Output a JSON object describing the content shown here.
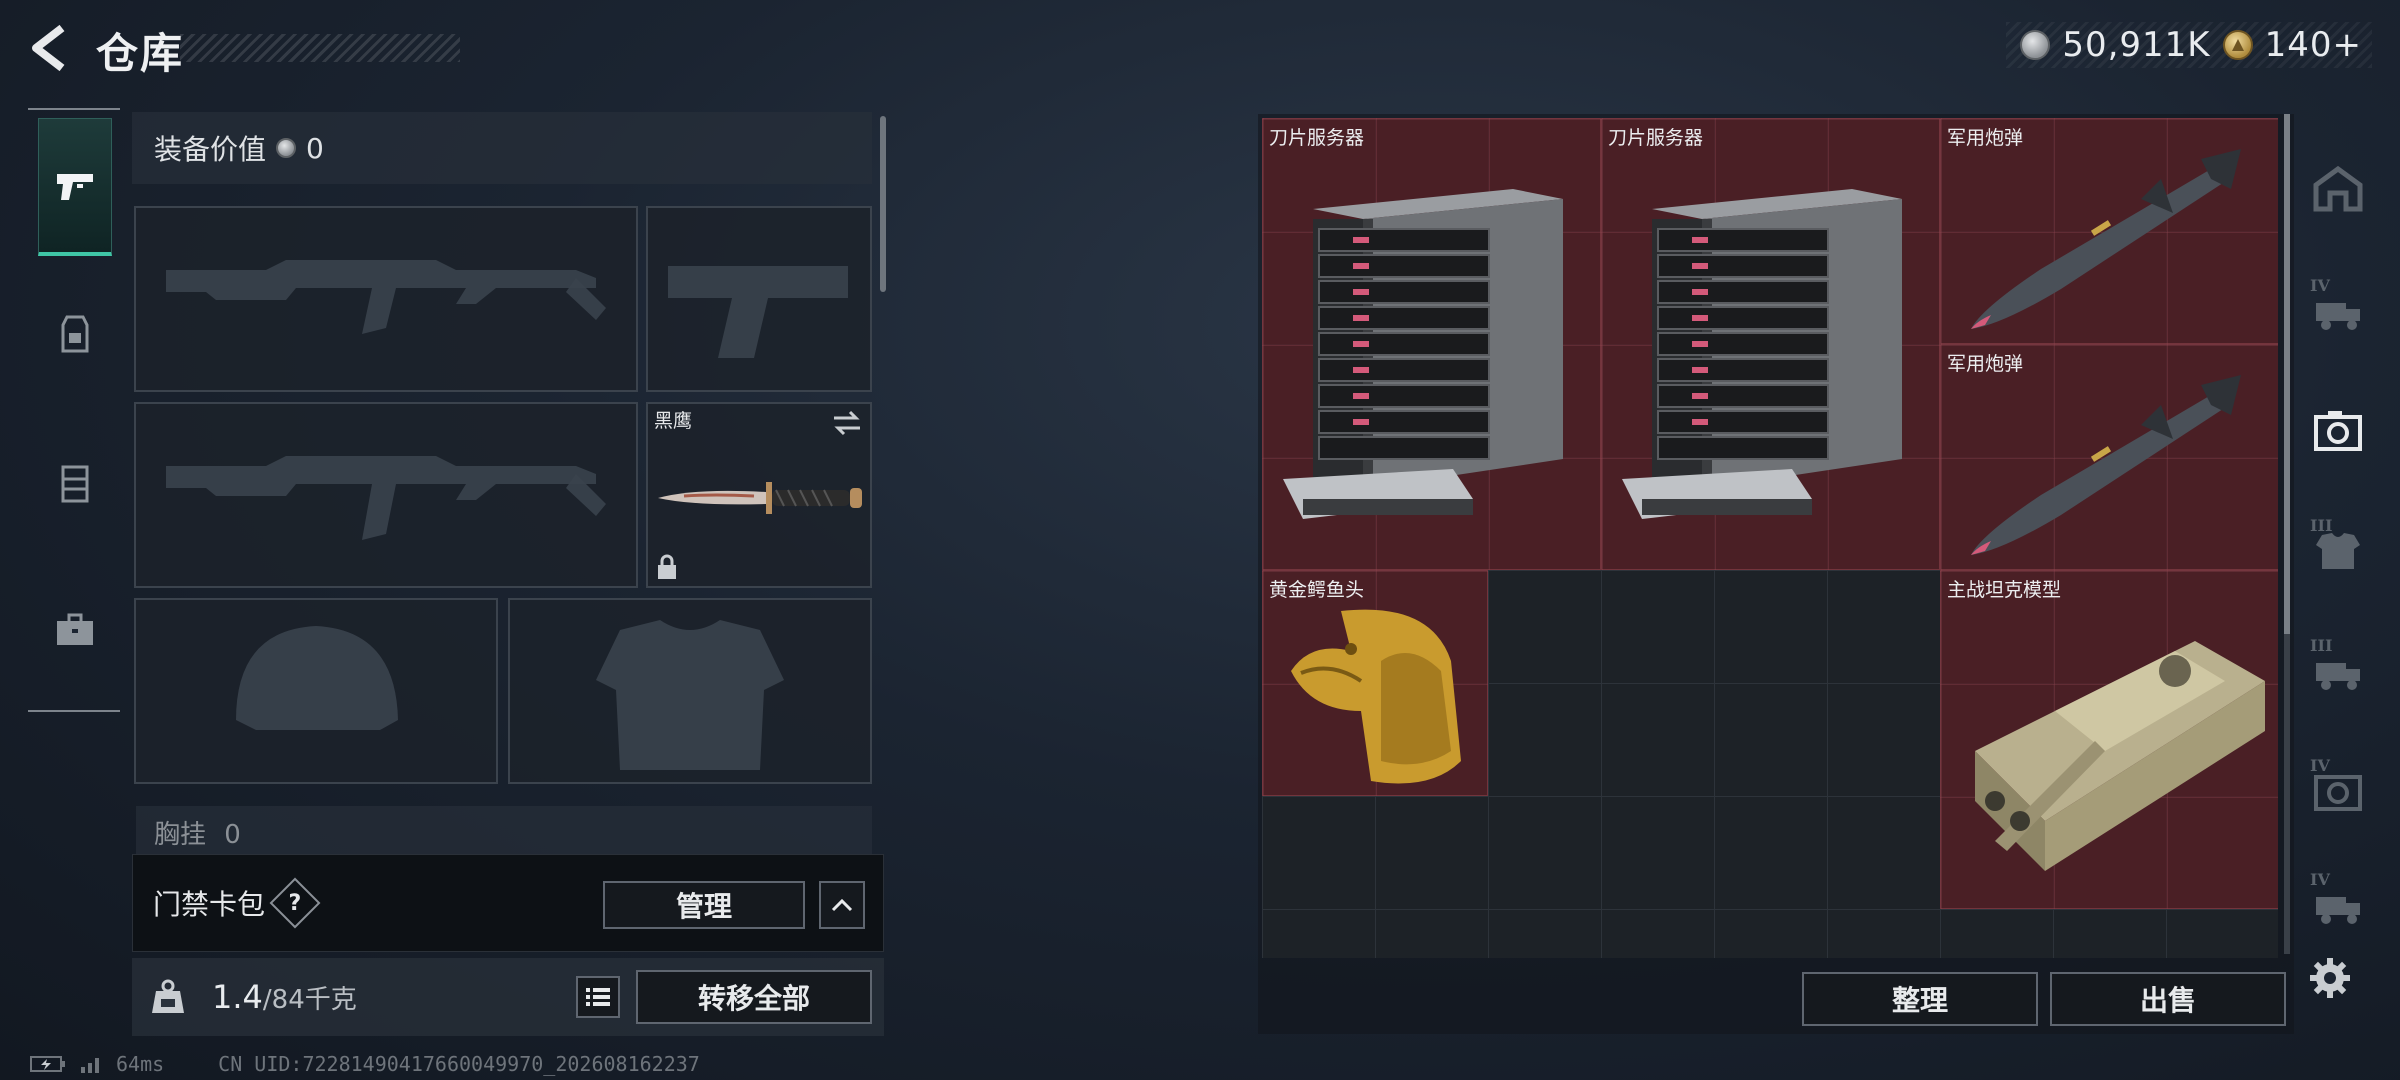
{
  "header": {
    "title": "仓库",
    "currency_silver": "50,911K",
    "currency_gold": "140+"
  },
  "left_tabs": [
    "pistol-icon",
    "backpack-icon",
    "rig-icon",
    "briefcase-icon"
  ],
  "equipment": {
    "value_label": "装备价值",
    "value_amount": "0",
    "melee_name": "黑鹰",
    "chest_rig_label": "胸挂",
    "chest_rig_value": "0"
  },
  "keycard": {
    "label": "门禁卡包",
    "help": "?",
    "manage_label": "管理"
  },
  "weight": {
    "current": "1.4",
    "max": "/84千克",
    "transfer_label": "转移全部"
  },
  "status": {
    "ping": "64ms",
    "uid": "CN UID:72281490417660049970_202608162237"
  },
  "storage": {
    "items": [
      {
        "name": "刀片服务器"
      },
      {
        "name": "刀片服务器"
      },
      {
        "name": "军用炮弹"
      },
      {
        "name": "军用炮弹"
      },
      {
        "name": "黄金鳄鱼头"
      },
      {
        "name": "主战坦克模型"
      }
    ],
    "sort_label": "整理",
    "sell_label": "出售"
  },
  "right_tabs": [
    {
      "icon": "home-icon",
      "tier": ""
    },
    {
      "icon": "truck-icon",
      "tier": "IV"
    },
    {
      "icon": "camera-icon",
      "tier": ""
    },
    {
      "icon": "armor-icon",
      "tier": "III"
    },
    {
      "icon": "truck-icon",
      "tier": "III"
    },
    {
      "icon": "camera-icon",
      "tier": "IV"
    },
    {
      "icon": "truck-icon",
      "tier": "IV"
    }
  ],
  "colors": {
    "item_bg": "#5c1e26",
    "active_tab_accent": "#3fc6a6"
  }
}
